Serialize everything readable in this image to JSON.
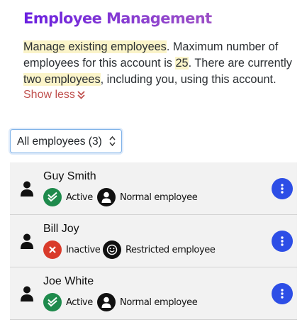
{
  "header": {
    "title": "Employee Management"
  },
  "description": {
    "part1": "Manage existing employees",
    "part2": ". Maximum number of employees for this account is ",
    "max": "25",
    "part3": ". There are currently ",
    "current": "two employees",
    "part4": ", including you, using this account."
  },
  "toggle": {
    "label": "Show less"
  },
  "filter": {
    "selected": "All employees (3)"
  },
  "employees": [
    {
      "name": "Guy Smith",
      "status": "Active",
      "status_icon": "check-icon",
      "type": "Normal employee",
      "type_icon": "user-icon"
    },
    {
      "name": "Bill Joy",
      "status": "Inactive",
      "status_icon": "x-icon",
      "type": "Restricted employee",
      "type_icon": "smile-icon"
    },
    {
      "name": "Joe White",
      "status": "Active",
      "status_icon": "check-icon",
      "type": "Normal employee",
      "type_icon": "user-icon"
    }
  ],
  "colors": {
    "title_gradient_start": "#6a1fe0",
    "title_gradient_end": "#9c4fc6",
    "highlight": "#fbf4c9",
    "show_less": "#c0514e",
    "active": "#1e8a4c",
    "inactive": "#d93b2b",
    "menu_button": "#2d4ee6",
    "row_background": "#f2f2f2"
  }
}
